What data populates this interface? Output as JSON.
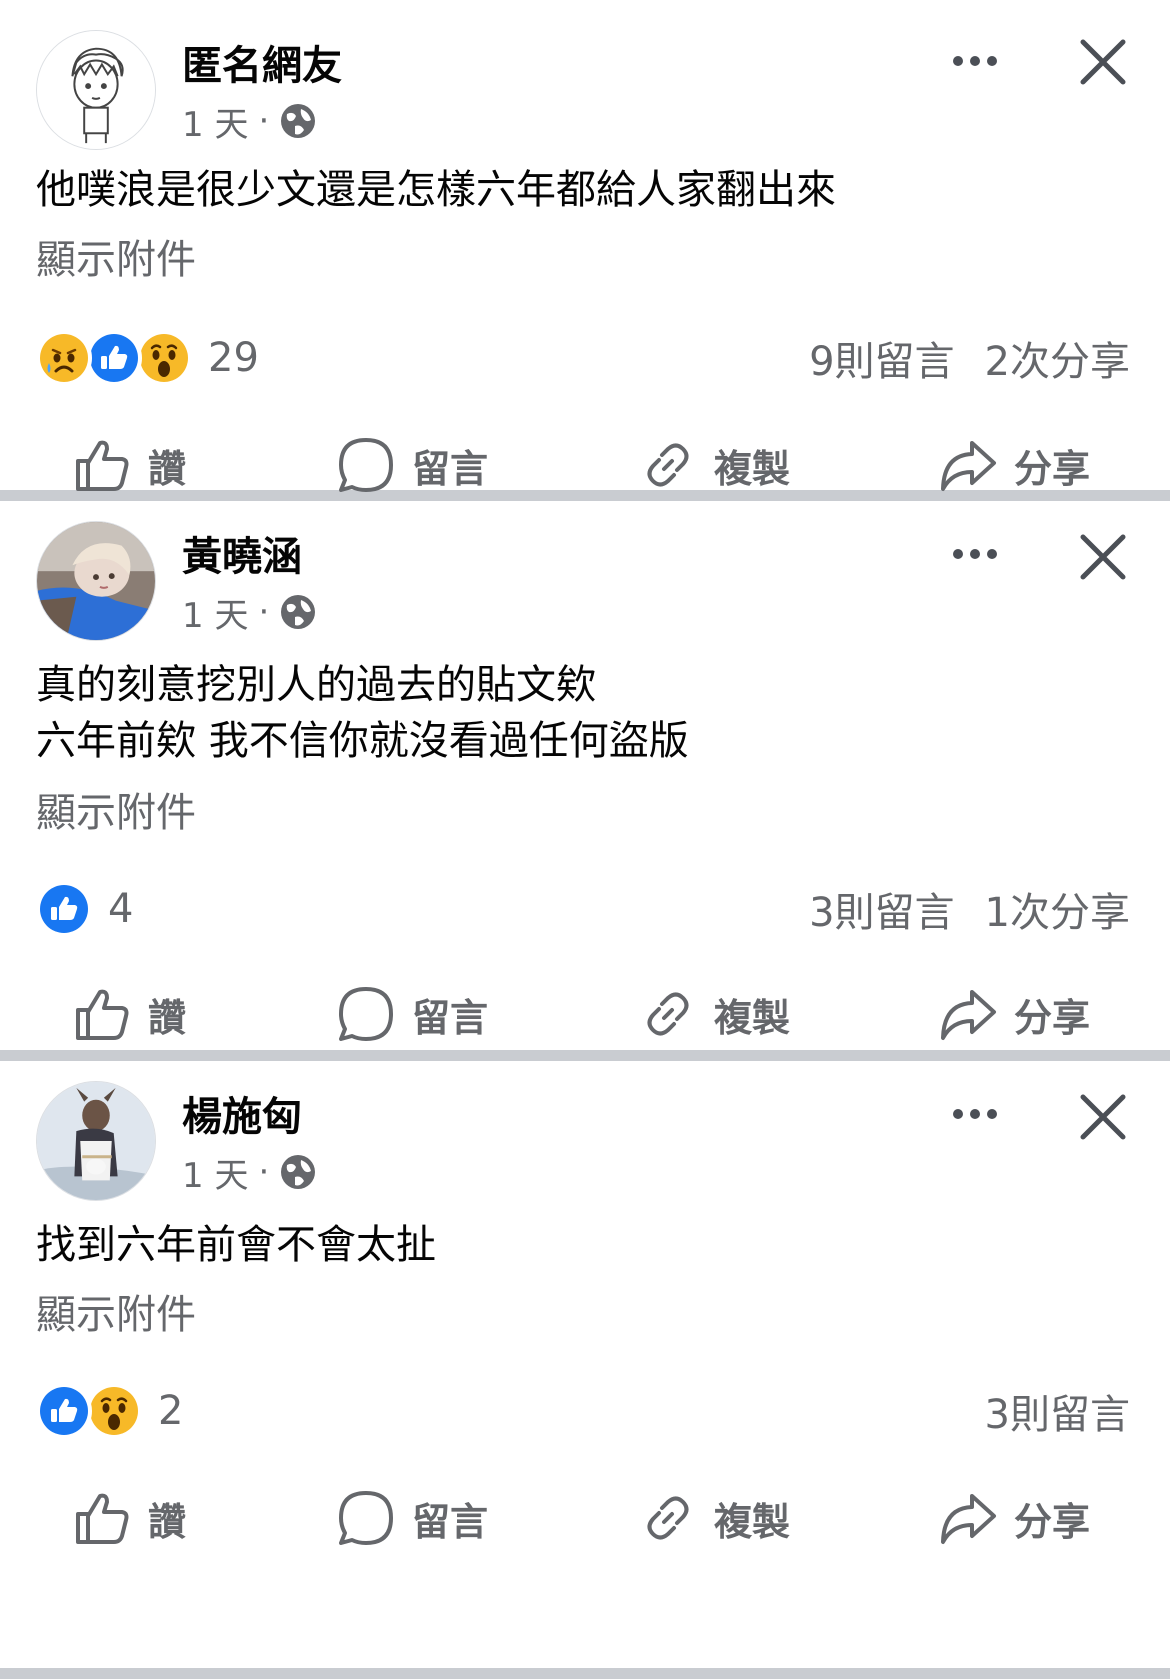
{
  "posts": [
    {
      "author": "匿名網友",
      "time": "1 天",
      "text_lines": [
        "他噗浪是很少文還是怎樣六年都給人家翻出來"
      ],
      "attachment_label": "顯示附件",
      "reactions": [
        "sad",
        "like",
        "wow"
      ],
      "reaction_count": "29",
      "comments": "9則留言",
      "shares": "2次分享"
    },
    {
      "author": "黃曉涵",
      "time": "1 天",
      "text_lines": [
        "真的刻意挖別人的過去的貼文欸",
        "六年前欸 我不信你就沒看過任何盜版"
      ],
      "attachment_label": "顯示附件",
      "reactions": [
        "like"
      ],
      "reaction_count": "4",
      "comments": "3則留言",
      "shares": "1次分享"
    },
    {
      "author": "楊施匈",
      "time": "1 天",
      "text_lines": [
        "找到六年前會不會太扯"
      ],
      "attachment_label": "顯示附件",
      "reactions": [
        "like",
        "wow"
      ],
      "reaction_count": "2",
      "comments": "3則留言",
      "shares": ""
    }
  ],
  "actions": {
    "like": "讚",
    "comment": "留言",
    "copy": "複製",
    "share": "分享"
  },
  "colors": {
    "like_blue": "#1877f2",
    "emoji_yellow": "#f7b928",
    "secondary_text": "#65676b",
    "separator": "#c9ccd1"
  }
}
